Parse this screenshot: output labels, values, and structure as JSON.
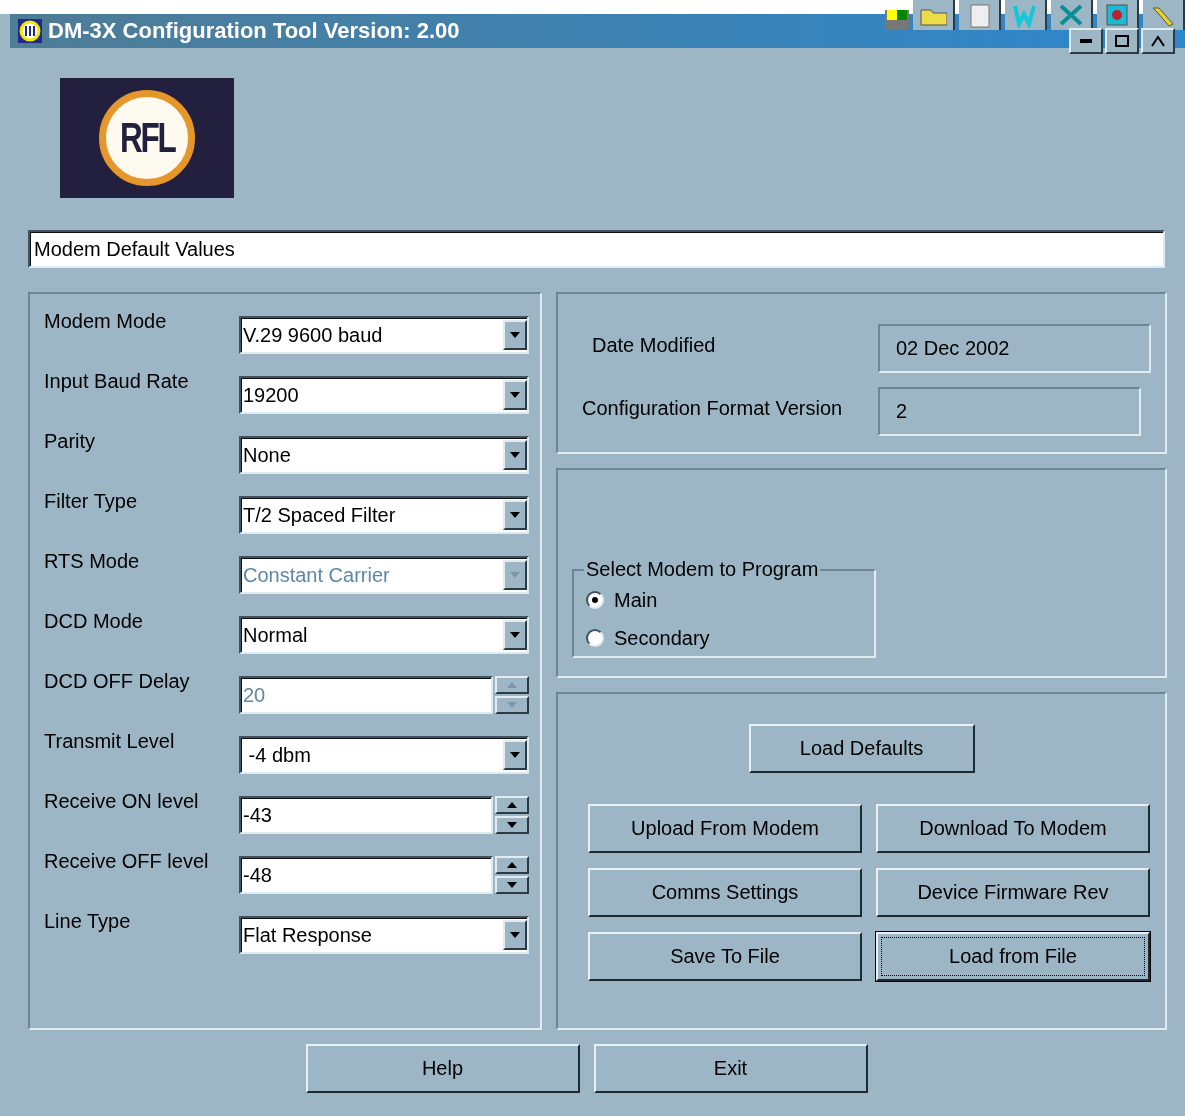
{
  "window": {
    "title": "DM-3X Configuration Tool Version: 2.00"
  },
  "logo": {
    "text": "RFL"
  },
  "status_field": {
    "value": "Modem Default Values"
  },
  "settings": [
    {
      "label": "Modem Mode",
      "kind": "select",
      "value": "V.29 9600 baud",
      "disabled": false
    },
    {
      "label": "Input Baud Rate",
      "kind": "select",
      "value": "19200",
      "disabled": false
    },
    {
      "label": "Parity",
      "kind": "select",
      "value": "None",
      "disabled": false
    },
    {
      "label": "Filter Type",
      "kind": "select",
      "value": "T/2 Spaced Filter",
      "disabled": false
    },
    {
      "label": "RTS Mode",
      "kind": "select",
      "value": "Constant Carrier",
      "disabled": true
    },
    {
      "label": "DCD Mode",
      "kind": "select",
      "value": "Normal",
      "disabled": false
    },
    {
      "label": "DCD OFF Delay",
      "kind": "spin",
      "value": "20",
      "disabled": true
    },
    {
      "label": "Transmit Level",
      "kind": "select",
      "value": " -4 dbm",
      "disabled": false
    },
    {
      "label": "Receive ON level",
      "kind": "spin",
      "value": "-43",
      "disabled": false
    },
    {
      "label": "Receive OFF level",
      "kind": "spin",
      "value": "-48",
      "disabled": false
    },
    {
      "label": "Line Type",
      "kind": "select",
      "value": "Flat Response",
      "disabled": false
    }
  ],
  "info": [
    {
      "label": "Date Modified",
      "value": "02 Dec 2002"
    },
    {
      "label": "Configuration Format Version",
      "value": "2"
    }
  ],
  "modem_select": {
    "title": "Select Modem to Program",
    "options": [
      {
        "label": "Main",
        "selected": true
      },
      {
        "label": "Secondary",
        "selected": false
      }
    ]
  },
  "action_buttons": [
    [
      {
        "label": "Load Defaults",
        "focused": false
      }
    ],
    [
      {
        "label": "Upload From Modem",
        "focused": false
      },
      {
        "label": "Download To Modem",
        "focused": false
      }
    ],
    [
      {
        "label": "Comms Settings",
        "focused": false
      },
      {
        "label": "Device Firmware Rev",
        "focused": false
      }
    ],
    [
      {
        "label": "Save To File",
        "focused": false
      },
      {
        "label": "Load from File",
        "focused": true
      }
    ]
  ],
  "footer_buttons": [
    {
      "label": "Help",
      "focused": false
    },
    {
      "label": "Exit",
      "focused": false
    }
  ]
}
